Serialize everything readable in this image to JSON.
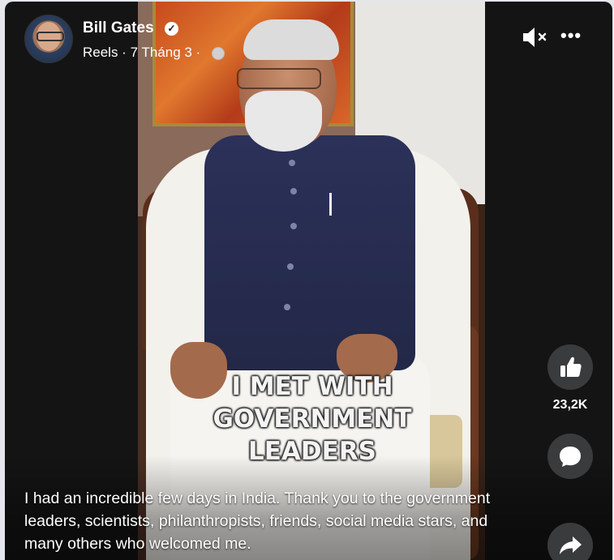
{
  "post": {
    "author": "Bill Gates",
    "meta_prefix": "Reels · 7 Tháng 3 ·",
    "verified_icon": "verified-badge-icon",
    "privacy_icon": "globe-icon"
  },
  "video": {
    "overlay_title": "I MET WITH\nGOVERNMENT\nLEADERS",
    "caption": "I had an incredible few days in India. Thank you to the government leaders, scientists, philanthropists, friends, social media stars, and many others who welcomed me."
  },
  "controls": {
    "mute_icon": "speaker-muted-icon",
    "more_label": "•••"
  },
  "actions": {
    "like_icon": "thumbs-up-icon",
    "like_count": "23,2K",
    "comment_icon": "comment-bubble-icon",
    "share_icon": "share-arrow-icon"
  },
  "colors": {
    "background": "#141414",
    "action_button": "#3a3b3c",
    "text": "#ffffff"
  }
}
